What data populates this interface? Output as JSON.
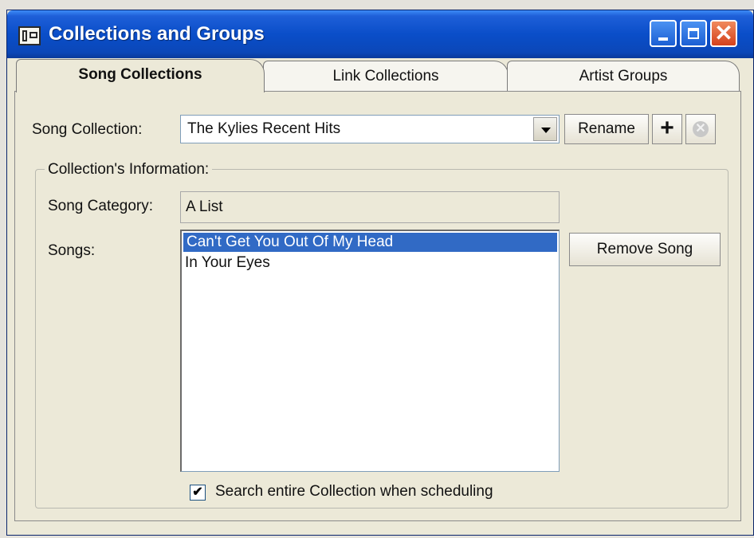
{
  "window": {
    "title": "Collections and Groups"
  },
  "tabs": [
    {
      "label": "Song Collections"
    },
    {
      "label": "Link Collections"
    },
    {
      "label": "Artist Groups"
    }
  ],
  "song_collection": {
    "label": "Song Collection:",
    "selected_value": "The Kylies Recent Hits",
    "rename_label": "Rename",
    "add_glyph": "+",
    "delete_glyph": "✕"
  },
  "collection_info": {
    "legend": "Collection's Information:",
    "category_label": "Song Category:",
    "category_value": "A List",
    "songs_label": "Songs:",
    "songs": [
      "Can't Get You Out Of My Head",
      "In Your Eyes"
    ],
    "selected_song_index": 0,
    "remove_label": "Remove Song",
    "search_checkbox_label": "Search entire Collection when scheduling",
    "search_checked": true,
    "check_glyph": "✔"
  },
  "colors": {
    "titlebar": "#0a4ec9",
    "selection": "#316ac5",
    "dialog_bg": "#ece9d8",
    "close_button": "#d4411c"
  },
  "icons": [
    "app-icon",
    "minimize-icon",
    "maximize-icon",
    "close-icon",
    "add-icon",
    "delete-icon",
    "dropdown-arrow-icon",
    "checkbox-check-icon"
  ]
}
